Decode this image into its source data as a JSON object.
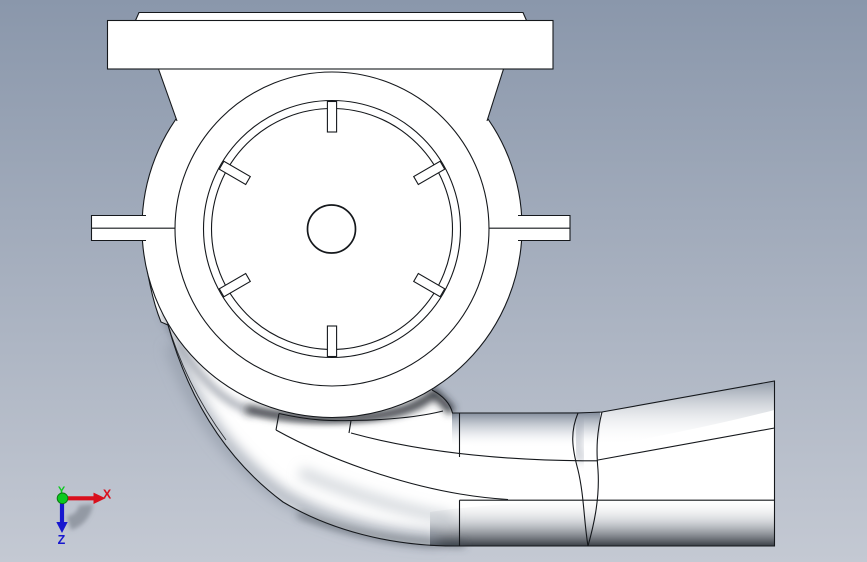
{
  "scene": {
    "background": {
      "top": "#8a97ab",
      "bottom": "#c4c9d3"
    },
    "edge_color": "#15181c",
    "surface_color": "#ffffff"
  },
  "impeller": {
    "blade_count": 6,
    "blade_step_deg": 60
  },
  "triad": {
    "axes": [
      {
        "label": "X",
        "color": "#d90f1c"
      },
      {
        "label": "Y",
        "color": "#0cc91f"
      },
      {
        "label": "Z",
        "color": "#1616cf"
      }
    ]
  }
}
